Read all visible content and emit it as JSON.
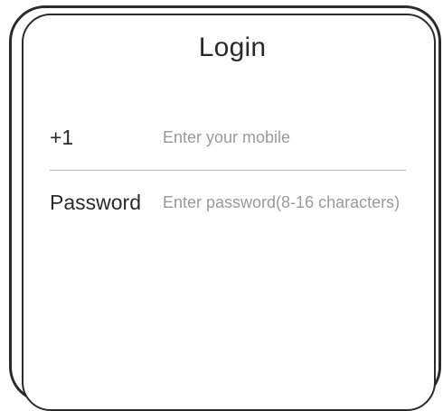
{
  "login": {
    "title": "Login",
    "phone": {
      "country_code": "+1",
      "placeholder": "Enter your mobile",
      "value": ""
    },
    "password": {
      "label": "Password",
      "placeholder": "Enter password(8-16 characters)",
      "value": ""
    }
  }
}
